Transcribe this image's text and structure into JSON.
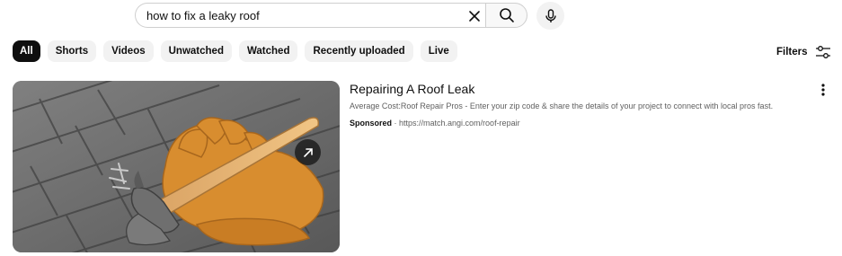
{
  "search": {
    "query": "how to fix a leaky roof"
  },
  "chips": [
    {
      "label": "All",
      "active": true
    },
    {
      "label": "Shorts",
      "active": false
    },
    {
      "label": "Videos",
      "active": false
    },
    {
      "label": "Unwatched",
      "active": false
    },
    {
      "label": "Watched",
      "active": false
    },
    {
      "label": "Recently uploaded",
      "active": false
    },
    {
      "label": "Live",
      "active": false
    }
  ],
  "filters": {
    "label": "Filters",
    "icon": "sliders-icon"
  },
  "ad": {
    "title": "Repairing A Roof Leak",
    "description": "Average Cost:Roof Repair Pros - Enter your zip code & share the details of your project to connect with local pros fast.",
    "sponsored_label": "Sponsored",
    "separator": " · ",
    "url": "https://match.angi.com/roof-repair",
    "thumbnail_subject": "hammer-and-gloves-on-shingles",
    "open_icon": "arrow-up-right-icon",
    "more_icon": "vertical-dots-icon"
  },
  "colors": {
    "chip_bg": "#f2f2f2",
    "chip_active_bg": "#0f0f0f",
    "text_primary": "#0f0f0f",
    "text_secondary": "#606060"
  }
}
